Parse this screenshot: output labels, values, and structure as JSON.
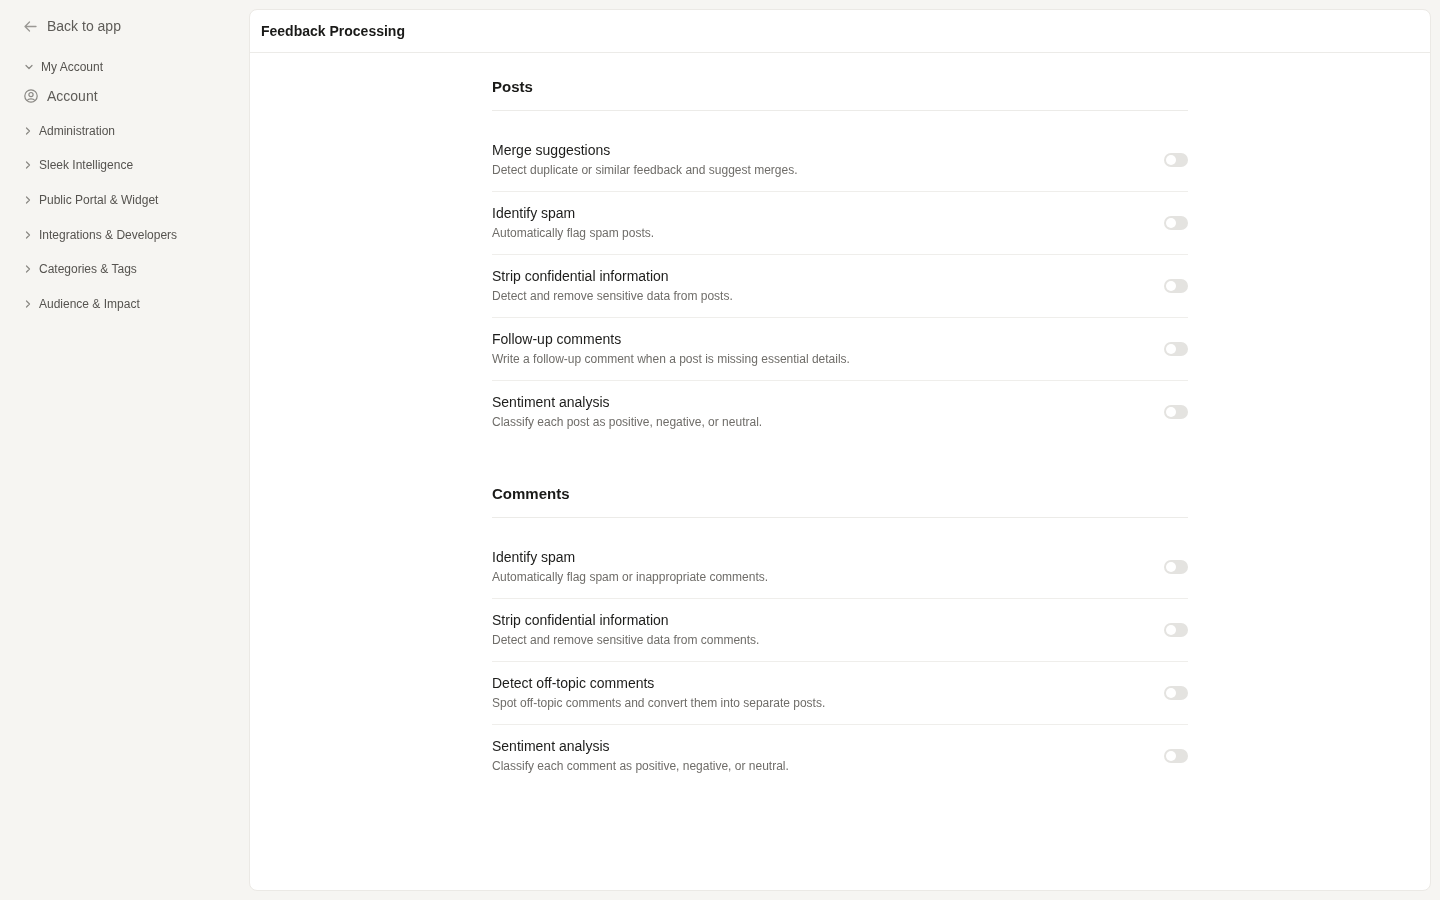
{
  "sidebar": {
    "back_link": {
      "label": "Back to app"
    },
    "sections": [
      {
        "label": "My Account",
        "expanded": true,
        "children": [
          {
            "label": "Account"
          }
        ]
      },
      {
        "label": "Administration",
        "expanded": false
      },
      {
        "label": "Sleek Intelligence",
        "expanded": false
      },
      {
        "label": "Public Portal & Widget",
        "expanded": false
      },
      {
        "label": "Integrations & Developers",
        "expanded": false
      },
      {
        "label": "Categories & Tags",
        "expanded": false
      },
      {
        "label": "Audience & Impact",
        "expanded": false
      }
    ]
  },
  "page": {
    "title": "Feedback Processing"
  },
  "groups": [
    {
      "title": "Posts",
      "settings": [
        {
          "title": "Merge suggestions",
          "description": "Detect duplicate or similar feedback and suggest merges.",
          "on": false
        },
        {
          "title": "Identify spam",
          "description": "Automatically flag spam posts.",
          "on": false
        },
        {
          "title": "Strip confidential information",
          "description": "Detect and remove sensitive data from posts.",
          "on": false
        },
        {
          "title": "Follow-up comments",
          "description": "Write a follow-up comment when a post is missing essential details.",
          "on": false
        },
        {
          "title": "Sentiment analysis",
          "description": "Classify each post as positive, negative, or neutral.",
          "on": false
        }
      ]
    },
    {
      "title": "Comments",
      "settings": [
        {
          "title": "Identify spam",
          "description": "Automatically flag spam or inappropriate comments.",
          "on": false
        },
        {
          "title": "Strip confidential information",
          "description": "Detect and remove sensitive data from comments.",
          "on": false
        },
        {
          "title": "Detect off-topic comments",
          "description": "Spot off-topic comments and convert them into separate posts.",
          "on": false
        },
        {
          "title": "Sentiment analysis",
          "description": "Classify each comment as positive, negative, or neutral.",
          "on": false
        }
      ]
    }
  ]
}
